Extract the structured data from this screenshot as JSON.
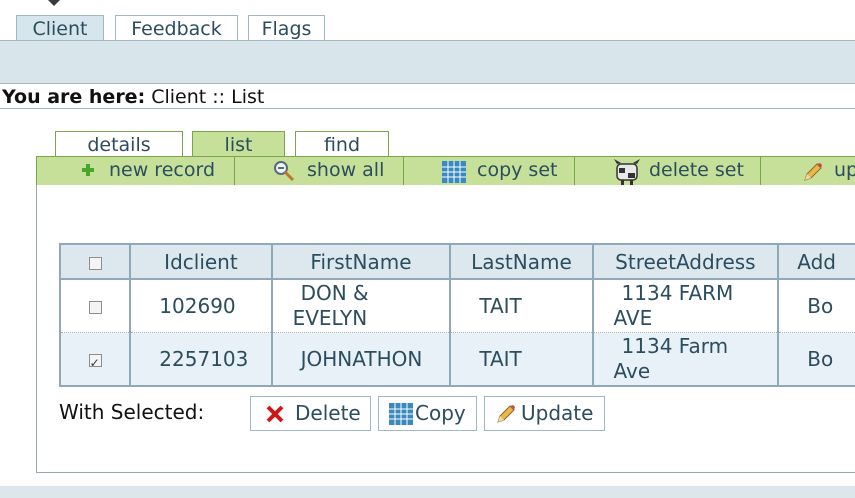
{
  "top_tabs": [
    {
      "label": "Client",
      "active": true
    },
    {
      "label": "Feedback",
      "active": false
    },
    {
      "label": "Flags",
      "active": false
    }
  ],
  "breadcrumb": {
    "prefix": "You are here:",
    "path": "Client :: List"
  },
  "sub_tabs": [
    {
      "label": "details",
      "active": false
    },
    {
      "label": "list",
      "active": true
    },
    {
      "label": "find",
      "active": false
    }
  ],
  "toolbar": {
    "new_record": "new record",
    "show_all": "show all",
    "copy_set": "copy set",
    "delete_set": "delete set",
    "update": "up"
  },
  "table": {
    "headers": [
      "Idclient",
      "FirstName",
      "LastName",
      "StreetAddress",
      "Add"
    ],
    "rows": [
      {
        "checked": false,
        "idclient": "102690",
        "firstname_1": "DON &",
        "firstname_2": "EVELYN",
        "lastname": "TAIT",
        "street_1": "1134 FARM",
        "street_2": "AVE",
        "add": "Bo"
      },
      {
        "checked": true,
        "idclient": "2257103",
        "firstname_1": "JOHNATHON",
        "firstname_2": "",
        "lastname": "TAIT",
        "street_1": "1134 Farm",
        "street_2": "Ave",
        "add": "Bo"
      }
    ]
  },
  "bulk": {
    "label": "With Selected:",
    "delete": "Delete",
    "copy": "Copy",
    "update": "Update"
  },
  "colors": {
    "accent_green": "#c6e09a",
    "header_blue": "#dce8ee",
    "border_blue": "#8faab6"
  }
}
